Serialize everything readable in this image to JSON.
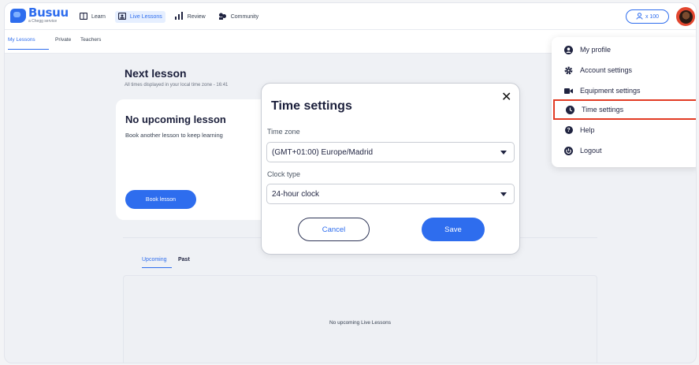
{
  "brand": {
    "name": "Busuu",
    "tagline": "a Chegg service"
  },
  "nav": {
    "items": [
      {
        "label": "Learn",
        "icon": "book-icon"
      },
      {
        "label": "Live Lessons",
        "icon": "video-lesson-icon",
        "active": true
      },
      {
        "label": "Review",
        "icon": "bar-chart-icon"
      },
      {
        "label": "Community",
        "icon": "community-icon"
      }
    ]
  },
  "header": {
    "points_label": "x 100",
    "points_icon": "user-outline-icon"
  },
  "subtabs": [
    "My Lessons",
    "Private",
    "Teachers"
  ],
  "next_lesson": {
    "title": "Next lesson",
    "subtitle": "All times displayed in your local time zone - 16:41"
  },
  "card": {
    "title": "No upcoming lesson",
    "subtitle": "Book another lesson to keep learning",
    "button": "Book lesson"
  },
  "lesson_tabs": {
    "upcoming": "Upcoming",
    "past": "Past"
  },
  "empty_state": "No upcoming Live Lessons",
  "modal": {
    "title": "Time settings",
    "close": "✕",
    "timezone_label": "Time zone",
    "timezone_value": "(GMT+01:00) Europe/Madrid",
    "clock_label": "Clock type",
    "clock_value": "24-hour clock",
    "cancel": "Cancel",
    "save": "Save"
  },
  "menu": {
    "items": [
      {
        "label": "My profile",
        "icon": "profile-icon"
      },
      {
        "label": "Account settings",
        "icon": "gear-icon"
      },
      {
        "label": "Equipment settings",
        "icon": "camera-icon"
      },
      {
        "label": "Time settings",
        "icon": "clock-icon",
        "highlight": true
      },
      {
        "label": "Help",
        "icon": "help-icon"
      },
      {
        "label": "Logout",
        "icon": "power-icon"
      }
    ]
  },
  "colors": {
    "accent": "#2e6dee",
    "highlight": "#e23b24",
    "text": "#1f2340"
  }
}
